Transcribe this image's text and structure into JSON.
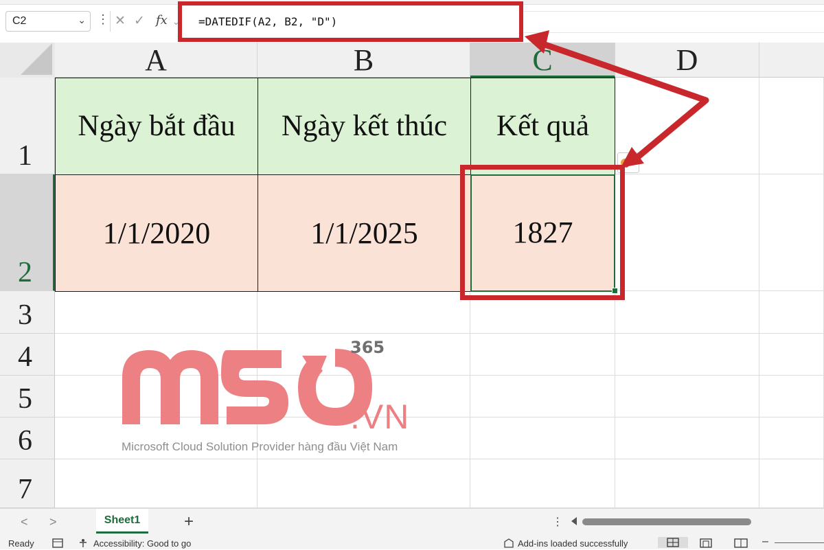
{
  "formula_bar": {
    "name_box": "C2",
    "name_box_chevron": "⌄",
    "more_dots": "⋮",
    "cancel_icon": "✕",
    "enter_icon": "✓",
    "fx_label": "fx",
    "fx_chevron": "⌄",
    "formula": "=DATEDIF(A2, B2, \"D\")"
  },
  "columns": [
    "A",
    "B",
    "C",
    "D"
  ],
  "rows": [
    "1",
    "2",
    "3",
    "4",
    "5",
    "6",
    "7"
  ],
  "cells": {
    "A1": "Ngày bắt đầu",
    "B1": "Ngày kết thúc",
    "C1": "Kết quả",
    "A2": "1/1/2020",
    "B2": "1/1/2025",
    "C2": "1827"
  },
  "colors": {
    "header_fill": "#dcf2d4",
    "value_fill": "#fbe2d7",
    "highlight_red": "#c8272b",
    "excel_green": "#1e6b3c"
  },
  "watermark": {
    "brand": "MSO",
    "superscript": "365",
    "suffix": ".VN",
    "tagline": "Microsoft Cloud Solution Provider hàng đầu Việt Nam"
  },
  "sheet_tabs": {
    "prev": "<",
    "next": ">",
    "active": "Sheet1",
    "add": "+",
    "more": "⋮"
  },
  "status_bar": {
    "ready": "Ready",
    "accessibility": "Accessibility: Good to go",
    "addins": "Add-ins loaded successfully",
    "zoom_minus": "–"
  }
}
